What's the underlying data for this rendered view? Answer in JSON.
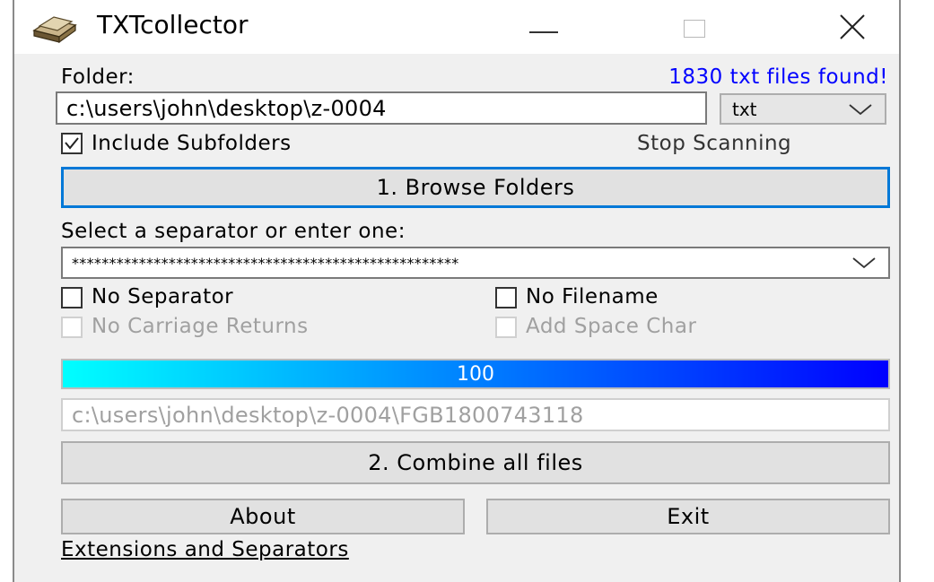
{
  "window": {
    "title": "TXTcollector",
    "app_icon": "stacked-books-icon",
    "controls": [
      "minimize-icon",
      "maximize-icon",
      "close-icon"
    ]
  },
  "folder": {
    "label": "Folder:",
    "status": "1830 txt files found!",
    "path": "c:\\users\\john\\desktop\\z-0004",
    "extension": "txt"
  },
  "options": {
    "include_subfolders": {
      "label": "Include Subfolders",
      "checked": true
    },
    "stop_scanning": "Stop Scanning"
  },
  "browse_button": "1. Browse Folders",
  "separator": {
    "label": "Select a separator or enter one:",
    "value": "****************************************************"
  },
  "checkboxes": {
    "no_separator": {
      "label": "No Separator",
      "checked": false,
      "enabled": true
    },
    "no_filename": {
      "label": "No Filename",
      "checked": false,
      "enabled": true
    },
    "no_carriage_returns": {
      "label": "No Carriage Returns",
      "checked": false,
      "enabled": false
    },
    "add_space_char": {
      "label": "Add Space Char",
      "checked": false,
      "enabled": false
    }
  },
  "progress": {
    "value": 100,
    "text": "100"
  },
  "current_file": "c:\\users\\john\\desktop\\z-0004\\FGB1800743118",
  "combine_button": "2. Combine all files",
  "about_button": "About",
  "exit_button": "Exit",
  "extensions_link": "Extensions and Separators",
  "colors": {
    "status_blue": "#0000ff",
    "focus_blue": "#0078d7",
    "progress_start": "#00ffff",
    "progress_end": "#0000ff"
  }
}
